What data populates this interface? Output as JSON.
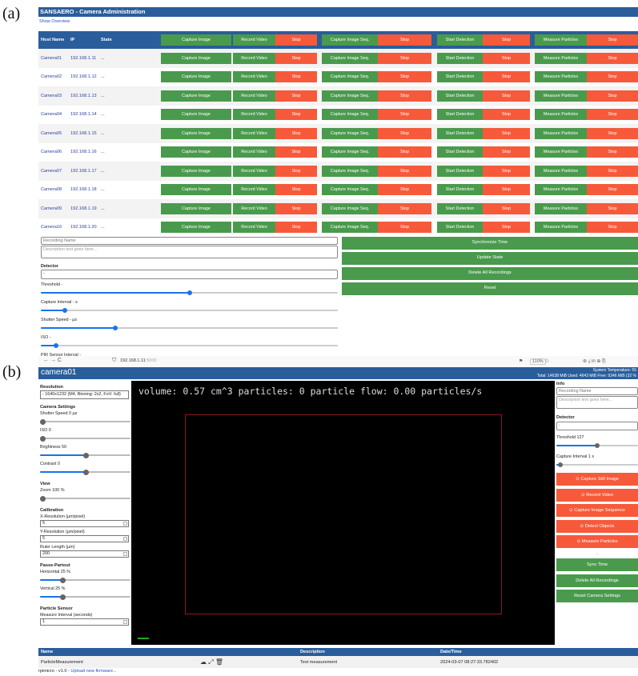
{
  "labels": {
    "a": "(a)",
    "b": "(b)"
  },
  "admin": {
    "title": "SANSAERO - Camera Administration",
    "show_overview": "Show Overview",
    "headers": {
      "host": "Host Name",
      "ip": "IP",
      "state": "State"
    },
    "actions": {
      "capture": "Capture Image",
      "record": "Record Video",
      "stop": "Stop",
      "capture_seq": "Capture Image Seq.",
      "start_detection": "Start Detection",
      "measure": "Measure Particles"
    },
    "cameras": [
      {
        "name": "Camera01",
        "ip": "192.168.1.11",
        "state": "..."
      },
      {
        "name": "Camera02",
        "ip": "192.168.1.12",
        "state": "..."
      },
      {
        "name": "Camera03",
        "ip": "192.168.1.13",
        "state": "..."
      },
      {
        "name": "Camera04",
        "ip": "192.168.1.14",
        "state": "..."
      },
      {
        "name": "Camera05",
        "ip": "192.168.1.15",
        "state": "..."
      },
      {
        "name": "Camera06",
        "ip": "192.168.1.16",
        "state": "..."
      },
      {
        "name": "Camera07",
        "ip": "192.168.1.17",
        "state": "..."
      },
      {
        "name": "Camera08",
        "ip": "192.168.1.18",
        "state": "..."
      },
      {
        "name": "Camera09",
        "ip": "192.168.1.19",
        "state": "..."
      },
      {
        "name": "Camera10",
        "ip": "192.168.1.20",
        "state": "..."
      }
    ],
    "form": {
      "recording_name_placeholder": "Recording Name",
      "description_placeholder": "Description text goes here...",
      "detector_label": "Detector",
      "detector_value": "-",
      "threshold_label": "Threshold -",
      "threshold_level": 0.5,
      "capture_interval_label": "Capture Interval - s",
      "capture_interval_level": 0.08,
      "shutter_label": "Shutter Speed - µs",
      "shutter_level": 0.25,
      "iso_label": "ISO -",
      "iso_level": 0.05,
      "pir_label": "PIR Sensor Interval -",
      "pir_level": 0.03
    },
    "global_buttons": [
      "Synchronize Time",
      "Update State",
      "Delete All Recordings",
      "Reset"
    ]
  },
  "browser": {
    "nav": "←  →  C",
    "url": "192.168.1.11",
    "port": ":5000",
    "zoom": "110%",
    "icons": "☆",
    "right_icons": "⊛  ⤓  in  ⊕  ⎘"
  },
  "camera": {
    "title": "camera01",
    "sys_line1": "System Temperature: 55",
    "sys_line2": "Total: 14638 MiB Used: 4643 MiB Free: 9346 MiB (32 %",
    "overlay": "volume: 0.57 cm^3  particles: 0  particle flow: 0.00 particles/s",
    "left": {
      "resolution_title": "Resolution",
      "resolution_value": "- 1640x1232 (M4, Binning: 2x2, FoV: full)",
      "settings_title": "Camera Settings",
      "shutter": "Shutter Speed 0 µs",
      "shutter_level": 0.0,
      "iso": "ISO 0",
      "iso_level": 0.0,
      "brightness": "Brightness 50",
      "brightness_level": 0.5,
      "contrast": "Contrast 0",
      "contrast_level": 0.5,
      "view_title": "View",
      "zoom": "Zoom 100 %",
      "zoom_level": 0.0,
      "calibration_title": "Calibration",
      "xres_label": "X-Resolution (µm/pixel)",
      "xres_value": "5",
      "yres_label": "Y-Resolution (µm/pixel)",
      "yres_value": "5",
      "ruler_label": "Ruler Length (µm)",
      "ruler_value": "200",
      "passe_title": "Passe-Partout",
      "horizontal": "Horizontal 25 %",
      "horizontal_level": 0.25,
      "vertical": "Vertical 25 %",
      "vertical_level": 0.25,
      "sensor_title": "Particle Sensor",
      "interval_label": "Measure Interval (seconds)",
      "interval_value": "1"
    },
    "right": {
      "info_title": "Info",
      "recording_name_placeholder": "Recording Name",
      "description_placeholder": "Description text goes here...",
      "detector_title": "Detector",
      "detector_value": "-",
      "threshold": "Threshold 127",
      "threshold_level": 0.5,
      "capture_interval": "Capture Interval 1 s",
      "capture_interval_level": 0.05,
      "action_buttons": [
        "⊙  Capture Still Image",
        "⊙  Record Video",
        "⊙  Capture Image Sequence",
        "⊙  Detect Objects",
        "⊙  Measure Particles"
      ],
      "dots": "...",
      "green_buttons": [
        "Sync Time",
        "Delete All Recordings",
        "Reset Camera Settings"
      ]
    },
    "table": {
      "headers": {
        "name": "Name",
        "description": "Description",
        "datetime": "Date/Time"
      },
      "rows": [
        {
          "name": "ParticleMeasurement",
          "icons": "☁ ⤢ 🗑",
          "description": "Test measurement",
          "datetime": "2024-03-07 08:27:33.782402"
        }
      ]
    },
    "footer": {
      "version": "rpimicro - v1.0 - ",
      "link": "Upload new firmware..."
    }
  }
}
